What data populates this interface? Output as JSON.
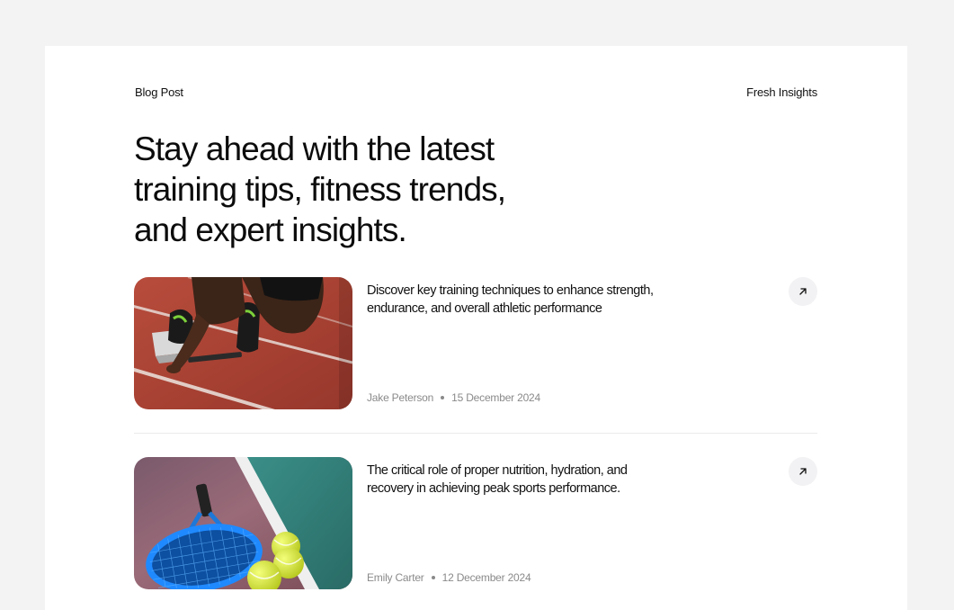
{
  "header": {
    "left_label": "Blog Post",
    "right_label": "Fresh Insights"
  },
  "headline": "Stay ahead with the latest training tips, fitness trends, and expert insights.",
  "posts": [
    {
      "title": "Discover key training techniques to enhance strength, endurance, and overall athletic performance",
      "author": "Jake Peterson",
      "date": "15 December 2024",
      "image": "sprinter-starting-blocks-photo",
      "icon": "arrow-up-right-icon"
    },
    {
      "title": "The critical role of proper nutrition, hydration, and recovery in achieving peak sports performance.",
      "author": "Emily Carter",
      "date": "12 December 2024",
      "image": "tennis-racket-balls-photo",
      "icon": "arrow-up-right-icon"
    }
  ],
  "colors": {
    "page_background": "#f3f3f3",
    "card_background": "#ffffff",
    "meta_text": "#8a8a8a",
    "button_background": "#f2f2f4",
    "track_red": "#b5483a",
    "court_green": "#2f7f78"
  }
}
